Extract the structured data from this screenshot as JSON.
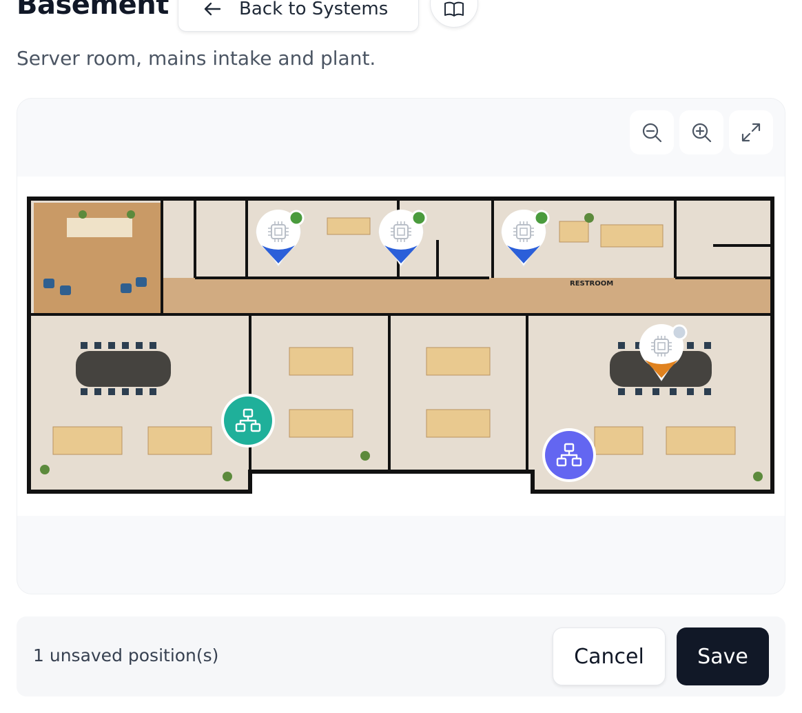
{
  "header": {
    "title": "Basement",
    "back_label": "Back to Systems",
    "back_icon": "arrow-left-icon",
    "book_icon": "book-icon"
  },
  "subtitle": "Server room, mains intake and plant.",
  "map": {
    "controls": [
      {
        "name": "zoom-out",
        "icon": "zoom-out-icon"
      },
      {
        "name": "zoom-in",
        "icon": "zoom-in-icon"
      },
      {
        "name": "fullscreen",
        "icon": "expand-icon"
      }
    ],
    "room_labels": [
      "RESTROOM"
    ],
    "markers": [
      {
        "type": "device",
        "icon": "chip-icon",
        "accent": "#2b5fd9",
        "status": "online",
        "status_color": "#4a9b3d"
      },
      {
        "type": "device",
        "icon": "chip-icon",
        "accent": "#2b5fd9",
        "status": "online",
        "status_color": "#4a9b3d"
      },
      {
        "type": "device",
        "icon": "chip-icon",
        "accent": "#2b5fd9",
        "status": "online",
        "status_color": "#4a9b3d"
      },
      {
        "type": "device",
        "icon": "chip-icon",
        "accent": "#e0821f",
        "status": "offline",
        "status_color": "#cbd5e1"
      },
      {
        "type": "network",
        "icon": "network-icon",
        "color": "#1fb09a"
      },
      {
        "type": "network",
        "icon": "network-icon",
        "color": "#6366f1"
      }
    ]
  },
  "footer": {
    "unsaved_text": "1 unsaved position(s)",
    "cancel_label": "Cancel",
    "save_label": "Save"
  },
  "colors": {
    "primary_button": "#111827",
    "device_blue": "#2b5fd9",
    "device_orange": "#e0821f",
    "network_teal": "#1fb09a",
    "network_indigo": "#6366f1",
    "status_online": "#4a9b3d",
    "status_offline": "#cbd5e1"
  }
}
